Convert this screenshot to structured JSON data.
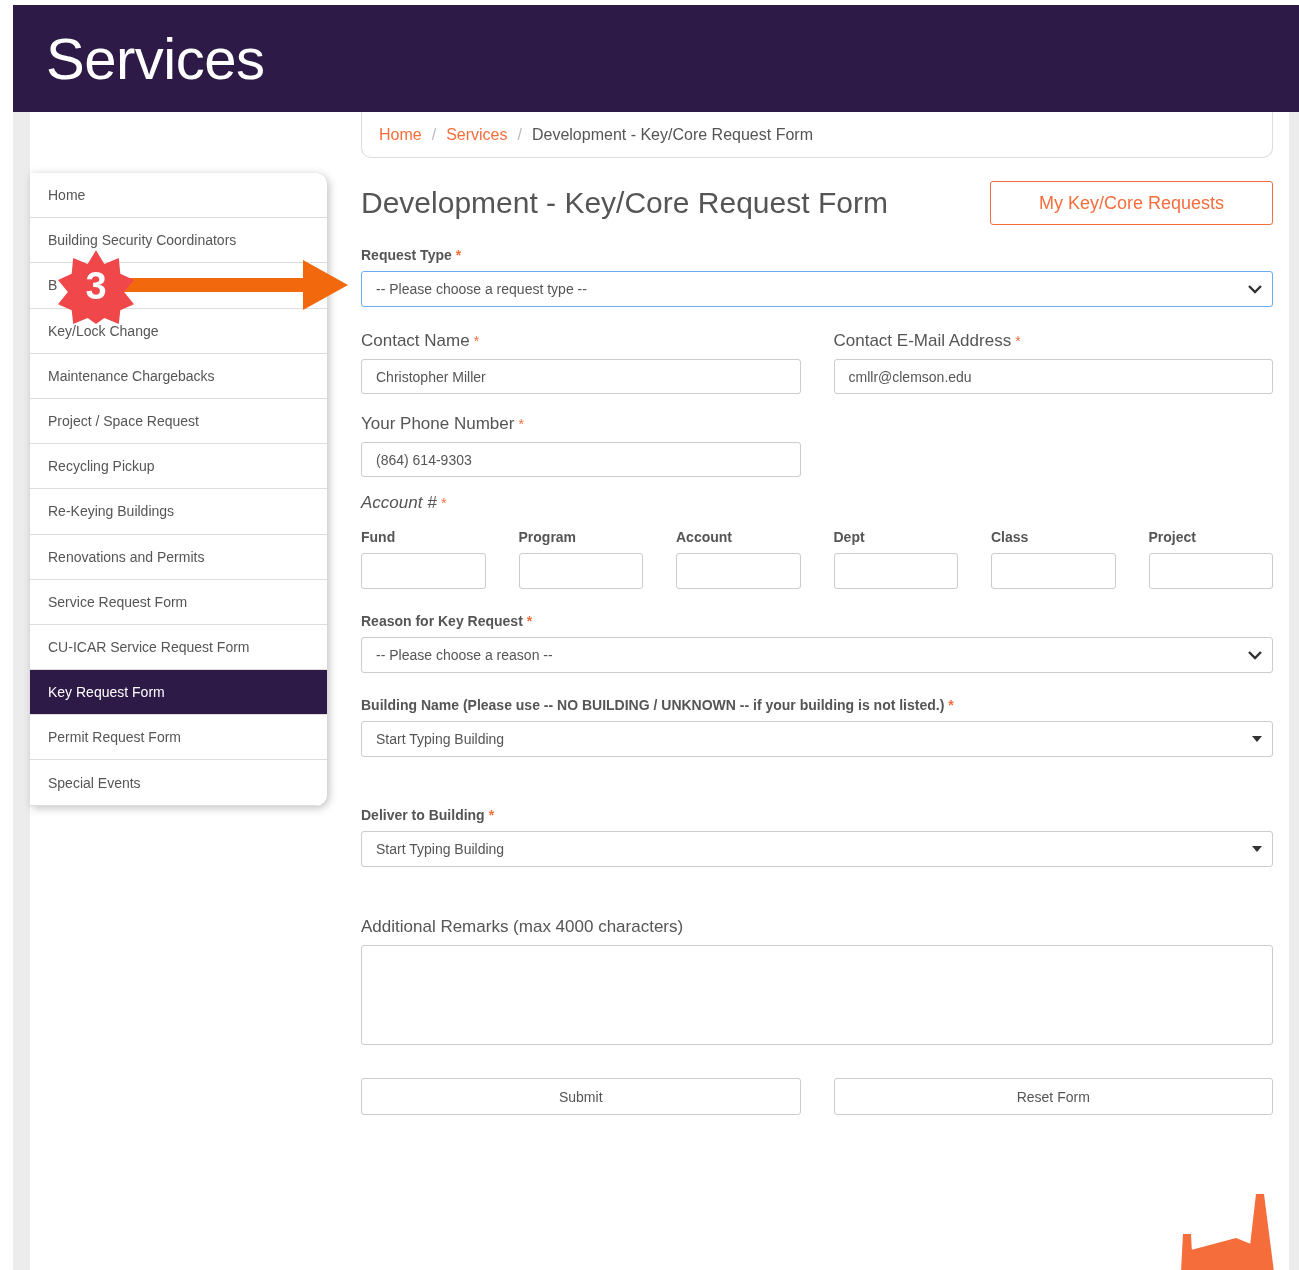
{
  "header": {
    "title": "Services"
  },
  "breadcrumb": [
    {
      "label": "Home",
      "link": true
    },
    {
      "separator_before": "/",
      "label": "Services",
      "link": true
    },
    {
      "separator_before": "/",
      "label": "Development - Key/Core Request Form",
      "link": false
    }
  ],
  "sidebar": {
    "items": [
      {
        "label": "Home",
        "selected": false
      },
      {
        "label": "Building Security Coordinators",
        "selected": false
      },
      {
        "label": "B",
        "selected": false
      },
      {
        "label": "Key/Lock Change",
        "selected": false
      },
      {
        "label": "Maintenance Chargebacks",
        "selected": false
      },
      {
        "label": "Project / Space Request",
        "selected": false
      },
      {
        "label": "Recycling Pickup",
        "selected": false
      },
      {
        "label": "Re-Keying Buildings",
        "selected": false
      },
      {
        "label": "Renovations and Permits",
        "selected": false
      },
      {
        "label": "Service Request Form",
        "selected": false
      },
      {
        "label": "CU-ICAR Service Request Form",
        "selected": false
      },
      {
        "label": "Key Request Form",
        "selected": true
      },
      {
        "label": "Permit Request Form",
        "selected": false
      },
      {
        "label": "Special Events",
        "selected": false
      }
    ]
  },
  "callout": {
    "number": "3"
  },
  "form": {
    "title": "Development - Key/Core Request Form",
    "my_requests_button": "My Key/Core Requests",
    "request_type": {
      "label": "Request Type",
      "required_mark": "*",
      "placeholder": "-- Please choose a request type --",
      "focused": true
    },
    "contact_name": {
      "label": "Contact Name",
      "required_mark": "*",
      "value": "Christopher Miller"
    },
    "contact_email": {
      "label": "Contact E-Mail Address",
      "required_mark": "*",
      "value": "cmllr@clemson.edu"
    },
    "phone": {
      "label": "Your Phone Number",
      "required_mark": "*",
      "value": "(864) 614-9303"
    },
    "account": {
      "label": "Account #",
      "required_mark": "*",
      "parts": [
        "Fund",
        "Program",
        "Account",
        "Dept",
        "Class",
        "Project"
      ]
    },
    "reason": {
      "label": "Reason for Key Request",
      "required_mark": "*",
      "placeholder": "-- Please choose a reason --",
      "focused": false
    },
    "building": {
      "label": "Building Name (Please use -- NO BUILDING / UNKNOWN -- if your building is not listed.)",
      "required_mark": "*",
      "placeholder": "Start Typing Building"
    },
    "deliver": {
      "label": "Deliver to Building",
      "required_mark": "*",
      "placeholder": "Start Typing Building"
    },
    "remarks": {
      "label": "Additional Remarks (max 4000 characters)"
    },
    "buttons": [
      "Submit",
      "Reset Form"
    ]
  }
}
